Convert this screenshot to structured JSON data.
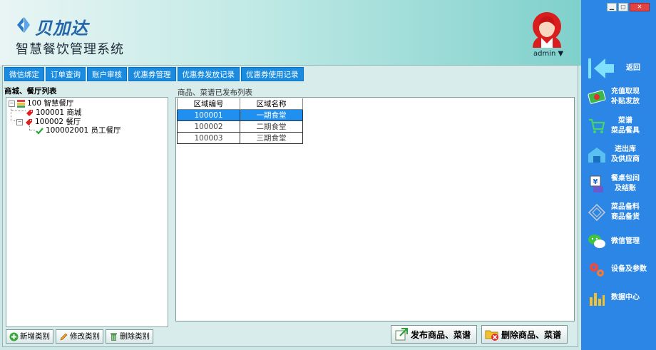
{
  "brand": {
    "logo_text": "贝加达",
    "app_title": "智慧餐饮管理系统"
  },
  "user": {
    "name": "admin ▼"
  },
  "tabs": [
    "微信绑定",
    "订单查询",
    "账户审核",
    "优惠券管理",
    "优惠券发放记录",
    "优惠券使用记录"
  ],
  "left_panel": {
    "title": "商城、餐厅列表",
    "tree": [
      {
        "text": "100  智慧餐厅",
        "level": 0,
        "icon": "stack-icon"
      },
      {
        "text": "100001  商城",
        "level": 1,
        "icon": "tag-icon"
      },
      {
        "text": "100002  餐厅",
        "level": 1,
        "icon": "tag-icon"
      },
      {
        "text": "100002001  员工餐厅",
        "level": 2,
        "icon": "check-icon"
      }
    ],
    "buttons": {
      "add": "新增类别",
      "edit": "修改类别",
      "delete": "删除类别"
    }
  },
  "right_panel": {
    "title": "商品、菜谱已发布列表",
    "columns": [
      "区域编号",
      "区域名称"
    ],
    "rows": [
      {
        "code": "100001",
        "name": "一期食堂",
        "selected": true
      },
      {
        "code": "100002",
        "name": "二期食堂",
        "selected": false
      },
      {
        "code": "100003",
        "name": "三期食堂",
        "selected": false
      }
    ],
    "buttons": {
      "publish": "发布商品、菜谱",
      "delete": "删除商品、菜谱"
    }
  },
  "sidebar": {
    "back": "返回",
    "items": [
      {
        "line1": "充值取现",
        "line2": "补贴发放",
        "icon": "cash-icon"
      },
      {
        "line1": "菜谱",
        "line2": "菜品餐具",
        "icon": "cart-icon"
      },
      {
        "line1": "进出库",
        "line2": "及供应商",
        "icon": "warehouse-icon"
      },
      {
        "line1": "餐桌包间",
        "line2": "及结账",
        "icon": "payment-icon"
      },
      {
        "line1": "菜品备料",
        "line2": "商品备货",
        "icon": "diamond-icon"
      },
      {
        "line1": "微信管理",
        "line2": "",
        "icon": "wechat-icon"
      },
      {
        "line1": "设备及参数",
        "line2": "",
        "icon": "gears-icon"
      },
      {
        "line1": "数据中心",
        "line2": "",
        "icon": "bar-chart-icon"
      }
    ]
  },
  "colors": {
    "tab_bg": "#1b8be0",
    "sidebar_bg": "#2b86e6",
    "selected_row": "#1f8ff0"
  }
}
